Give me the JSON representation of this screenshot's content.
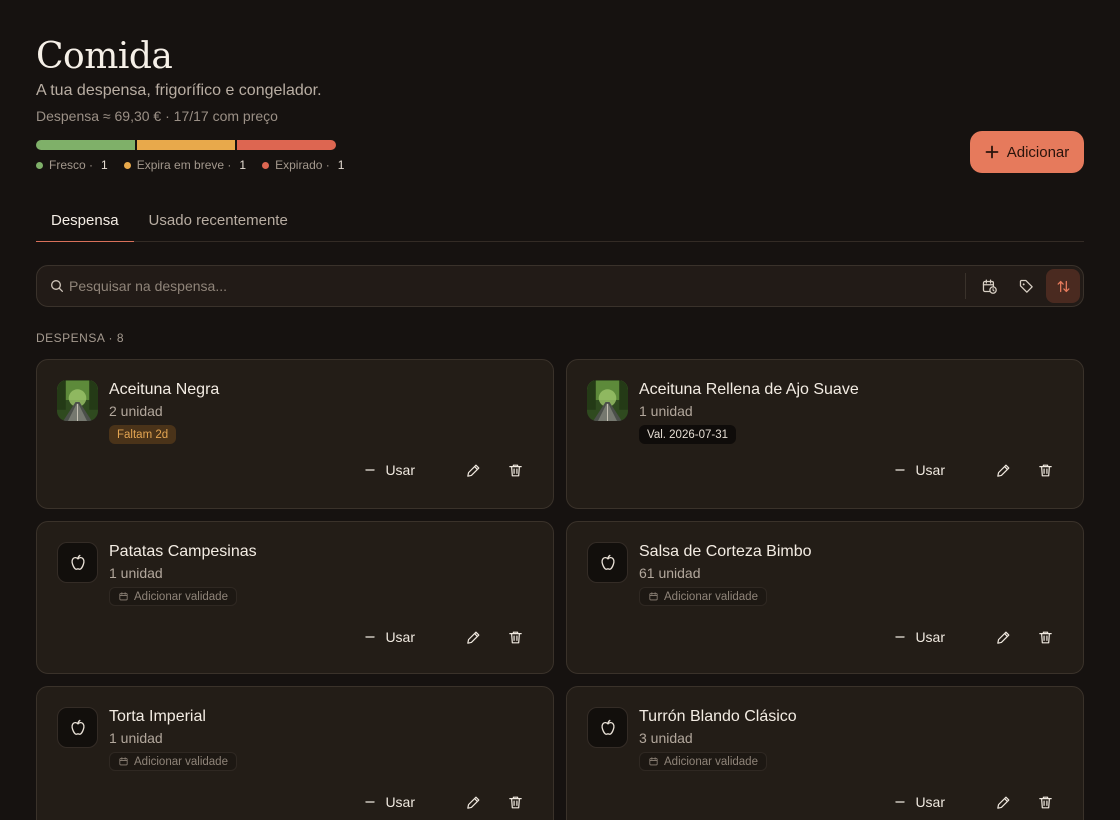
{
  "header": {
    "title": "Comida",
    "subtitle": "A tua despensa, frigorífico e congelador.",
    "meta": "Despensa ≈ 69,30 € · 17/17 com preço",
    "add_label": "Adicionar"
  },
  "status": {
    "fresh": {
      "label": "Fresco ·",
      "count": "1",
      "color": "#7fb069"
    },
    "soon": {
      "label": "Expira em breve ·",
      "count": "1",
      "color": "#e8a94b"
    },
    "expired": {
      "label": "Expirado ·",
      "count": "1",
      "color": "#dd6651"
    }
  },
  "tabs": [
    {
      "label": "Despensa"
    },
    {
      "label": "Usado recentemente"
    }
  ],
  "search": {
    "placeholder": "Pesquisar na despensa..."
  },
  "section": {
    "label": "DESPENSA · 8"
  },
  "items": [
    {
      "name": "Aceituna Negra",
      "qty": "2 unidad",
      "badge": "Faltam 2d",
      "use": "Usar"
    },
    {
      "name": "Aceituna Rellena de Ajo Suave",
      "qty": "1 unidad",
      "badge": "Val. 2026-07-31",
      "use": "Usar"
    },
    {
      "name": "Patatas Campesinas",
      "qty": "1 unidad",
      "badge": "Adicionar validade",
      "use": "Usar"
    },
    {
      "name": "Salsa de Corteza Bimbo",
      "qty": "61 unidad",
      "badge": "Adicionar validade",
      "use": "Usar"
    },
    {
      "name": "Torta Imperial",
      "qty": "1 unidad",
      "badge": "Adicionar validade",
      "use": "Usar"
    },
    {
      "name": "Turrón Blando Clásico",
      "qty": "3 unidad",
      "badge": "Adicionar validade",
      "use": "Usar"
    }
  ],
  "colors": {
    "accent": "#e67a5c",
    "background": "#161210",
    "card": "#231d17"
  }
}
